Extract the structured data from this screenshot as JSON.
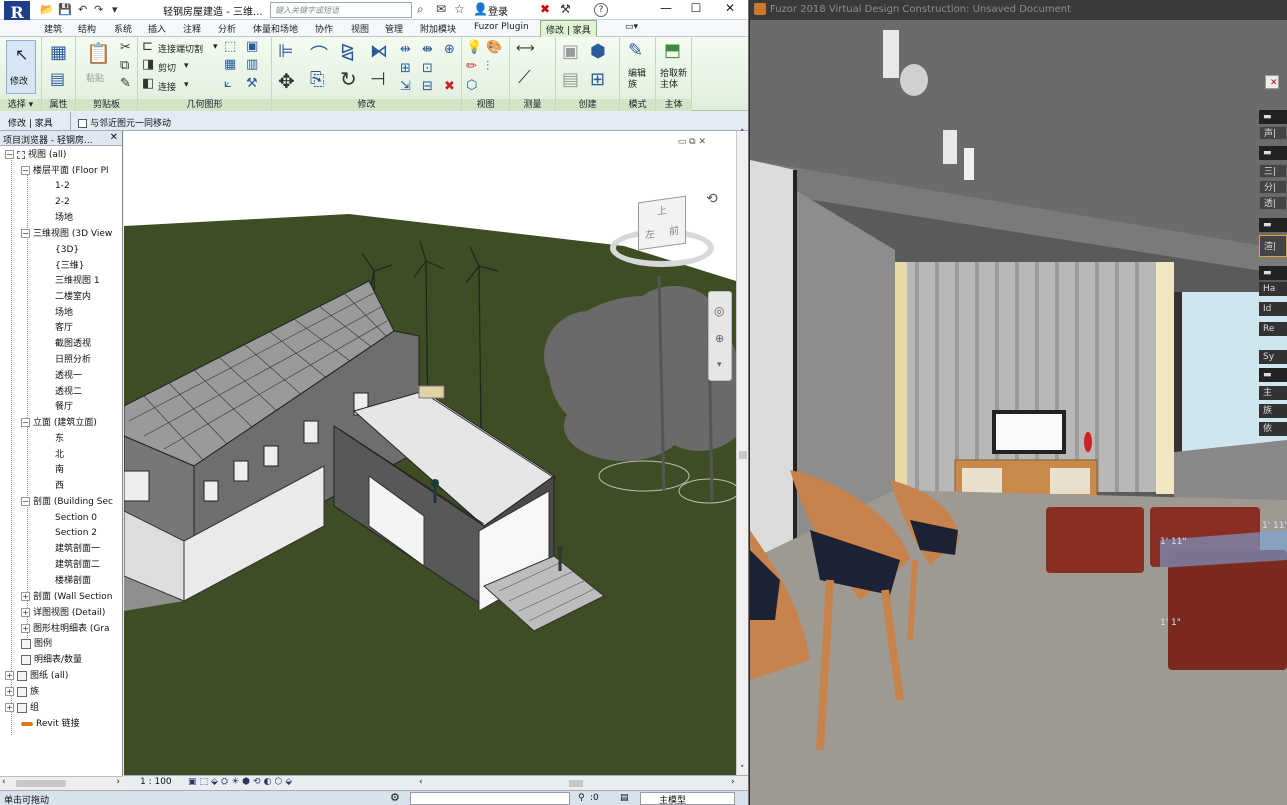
{
  "revit": {
    "app_logo": "R",
    "document_title": "轻钢房屋建造 - 三维...",
    "search_placeholder": "键入关键字或短语",
    "login_label": "登录",
    "help_label": "?",
    "tabs": [
      {
        "label": "建筑"
      },
      {
        "label": "结构"
      },
      {
        "label": "系统"
      },
      {
        "label": "插入"
      },
      {
        "label": "注释"
      },
      {
        "label": "分析"
      },
      {
        "label": "体量和场地"
      },
      {
        "label": "协作"
      },
      {
        "label": "视图"
      },
      {
        "label": "管理"
      },
      {
        "label": "附加模块"
      },
      {
        "label": "Fuzor Plugin"
      },
      {
        "label": "修改 | 家具"
      }
    ],
    "ribbon": {
      "select_label": "选择",
      "modify_button": "修改",
      "properties_label": "属性",
      "clipboard_label": "剪贴板",
      "paste_button": "粘贴",
      "geometry_label": "几何图形",
      "join_cut": "连接端切割",
      "cut": "剪切",
      "join": "连接",
      "modify_label": "修改",
      "view_label": "视图",
      "measure_label": "测量",
      "create_label": "创建",
      "mode_label": "模式",
      "edit_family_button": "编辑族",
      "host_label": "主体",
      "pick_host_button": "拾取新主体"
    },
    "options_bar": {
      "context": "修改 | 家具",
      "move_with_nearby": "与邻近图元一同移动"
    },
    "browser": {
      "title": "项目浏览器 - 轻钢房...",
      "items": [
        {
          "label": "视图 (all)"
        },
        {
          "label": "楼层平面 (Floor Pl"
        },
        {
          "label": "1-2"
        },
        {
          "label": "2-2"
        },
        {
          "label": "场地"
        },
        {
          "label": "三维视图 (3D View"
        },
        {
          "label": "{3D}"
        },
        {
          "label": "{三维}"
        },
        {
          "label": "三维视图 1"
        },
        {
          "label": "二楼室内"
        },
        {
          "label": "场地"
        },
        {
          "label": "客厅"
        },
        {
          "label": "截图透视"
        },
        {
          "label": "日照分析"
        },
        {
          "label": "透视一"
        },
        {
          "label": "透视二"
        },
        {
          "label": "餐厅"
        },
        {
          "label": "立面 (建筑立面)"
        },
        {
          "label": "东"
        },
        {
          "label": "北"
        },
        {
          "label": "南"
        },
        {
          "label": "西"
        },
        {
          "label": "剖面 (Building Sec"
        },
        {
          "label": "Section 0"
        },
        {
          "label": "Section 2"
        },
        {
          "label": "建筑剖面一"
        },
        {
          "label": "建筑剖面二"
        },
        {
          "label": "楼梯剖面"
        },
        {
          "label": "剖面 (Wall Section"
        },
        {
          "label": "详图视图 (Detail)"
        },
        {
          "label": "图形柱明细表 (Gra"
        },
        {
          "label": "图例"
        },
        {
          "label": "明细表/数量"
        },
        {
          "label": "图纸 (all)"
        },
        {
          "label": "族"
        },
        {
          "label": "组"
        },
        {
          "label": "Revit 链接"
        }
      ]
    },
    "viewcube": {
      "top": "上",
      "left": "左",
      "front": "前"
    },
    "view_bar": {
      "scale": "1 : 100"
    },
    "status_bar": {
      "message": "单击可拖动",
      "selection_count": ":0",
      "model": "主模型"
    }
  },
  "fuzor": {
    "title": "Fuzor 2018 Virtual Design Construction: Unsaved Document",
    "panel": [
      {
        "label": "",
        "kind": "close"
      },
      {
        "label": "声|",
        "kind": "item"
      },
      {
        "label": "",
        "kind": "head"
      },
      {
        "label": "三|",
        "kind": "item"
      },
      {
        "label": "分|",
        "kind": "item"
      },
      {
        "label": "透|",
        "kind": "item"
      },
      {
        "label": "",
        "kind": "head"
      },
      {
        "label": "渲|",
        "kind": "active"
      },
      {
        "label": "",
        "kind": "head"
      },
      {
        "label": "Ha",
        "kind": "text"
      },
      {
        "label": "Id",
        "kind": "text"
      },
      {
        "label": "Re",
        "kind": "text"
      },
      {
        "label": "Sy",
        "kind": "text"
      },
      {
        "label": "",
        "kind": "head"
      },
      {
        "label": "主",
        "kind": "text"
      },
      {
        "label": "族",
        "kind": "text"
      },
      {
        "label": "依",
        "kind": "text"
      }
    ],
    "dimensions": {
      "d1": "1' 11\"",
      "d2": "1' 1\"",
      "d3": "1' 11\""
    }
  }
}
